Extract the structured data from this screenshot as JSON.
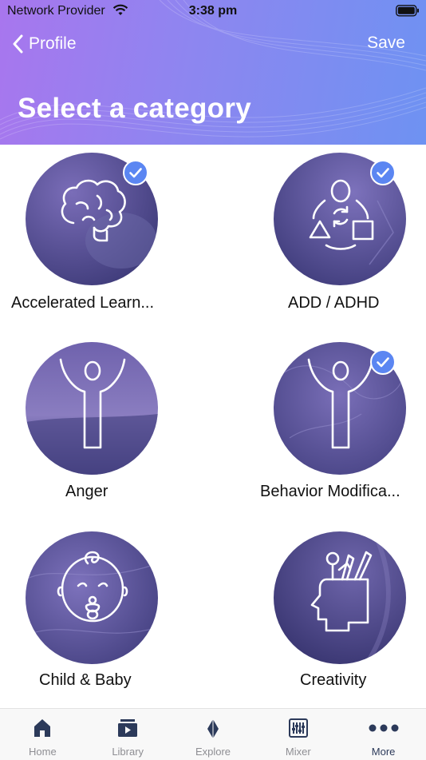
{
  "status_bar": {
    "carrier": "Network Provider",
    "time": "3:38 pm"
  },
  "header": {
    "back_label": "Profile",
    "save_label": "Save",
    "title": "Select a category"
  },
  "categories": [
    {
      "label": "Accelerated Learn...",
      "checked": true,
      "icon": "brain-icon"
    },
    {
      "label": "ADD / ADHD",
      "checked": true,
      "icon": "cycle-shapes-icon"
    },
    {
      "label": "Anger",
      "checked": false,
      "icon": "raised-arms-figure-icon"
    },
    {
      "label": "Behavior Modifica...",
      "checked": true,
      "icon": "raised-arms-figure-icon"
    },
    {
      "label": "Child & Baby",
      "checked": false,
      "icon": "baby-face-icon"
    },
    {
      "label": "Creativity",
      "checked": false,
      "icon": "creative-head-icon"
    }
  ],
  "tabs": [
    {
      "label": "Home",
      "icon": "home-icon",
      "active": false
    },
    {
      "label": "Library",
      "icon": "library-icon",
      "active": false
    },
    {
      "label": "Explore",
      "icon": "explore-icon",
      "active": false
    },
    {
      "label": "Mixer",
      "icon": "mixer-icon",
      "active": false
    },
    {
      "label": "More",
      "icon": "more-icon",
      "active": true
    }
  ],
  "colors": {
    "header_start": "#a876ee",
    "header_end": "#6e92f2",
    "check": "#5b86f2",
    "circle_dark": "#3d3a78",
    "circle_light": "#7a6db8"
  }
}
